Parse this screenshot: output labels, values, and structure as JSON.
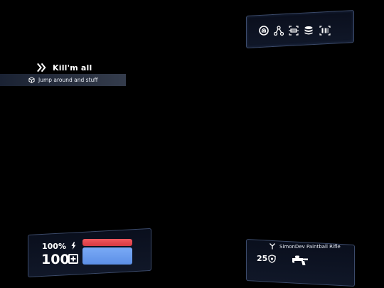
{
  "objective": {
    "title": "Kill'm all",
    "subtitle": "Jump around and stuff"
  },
  "status_icons": [
    "fingerprint-icon",
    "network-icon",
    "scanner-icon",
    "database-icon",
    "barcode-icon"
  ],
  "player": {
    "stamina_label": "100%",
    "stamina_fraction": 1.0,
    "health_value": "100",
    "health_fraction": 1.0
  },
  "weapon": {
    "name": "SimonDev Paintball Rifle",
    "ammo": "25"
  },
  "colors": {
    "background": "#000000",
    "panel_border": "#3b4a6a",
    "stamina_bar": "#e2454c",
    "health_bar": "#6b9cf0",
    "objective_bar": "#2a3140"
  }
}
